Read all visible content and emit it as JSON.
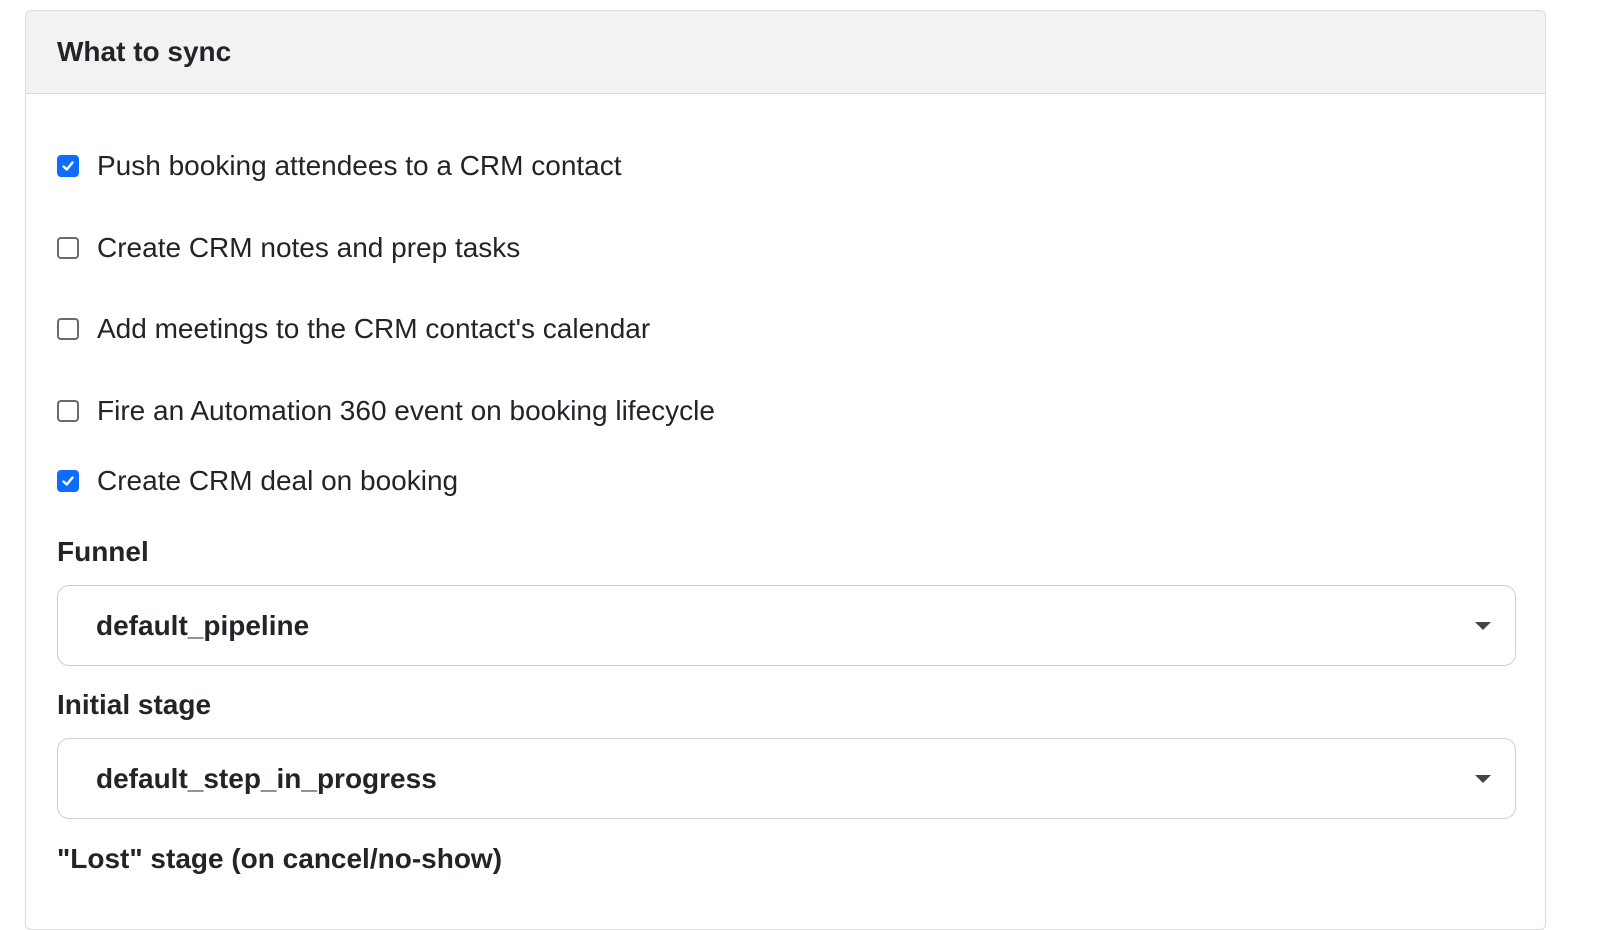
{
  "header": {
    "title": "What to sync"
  },
  "options": [
    {
      "label": "Push booking attendees to a CRM contact",
      "checked": true
    },
    {
      "label": "Create CRM notes and prep tasks",
      "checked": false
    },
    {
      "label": "Add meetings to the CRM contact's calendar",
      "checked": false
    },
    {
      "label": "Fire an Automation 360 event on booking lifecycle",
      "checked": false
    },
    {
      "label": "Create CRM deal on booking",
      "checked": true
    }
  ],
  "funnel": {
    "label": "Funnel",
    "value": "default_pipeline"
  },
  "initial_stage": {
    "label": "Initial stage",
    "value": "default_step_in_progress"
  },
  "lost_stage": {
    "label": "\"Lost\" stage (on cancel/no-show)"
  },
  "colors": {
    "accent": "#0d6efd",
    "header_bg": "#f2f2f2",
    "border": "#dcdcdc"
  }
}
